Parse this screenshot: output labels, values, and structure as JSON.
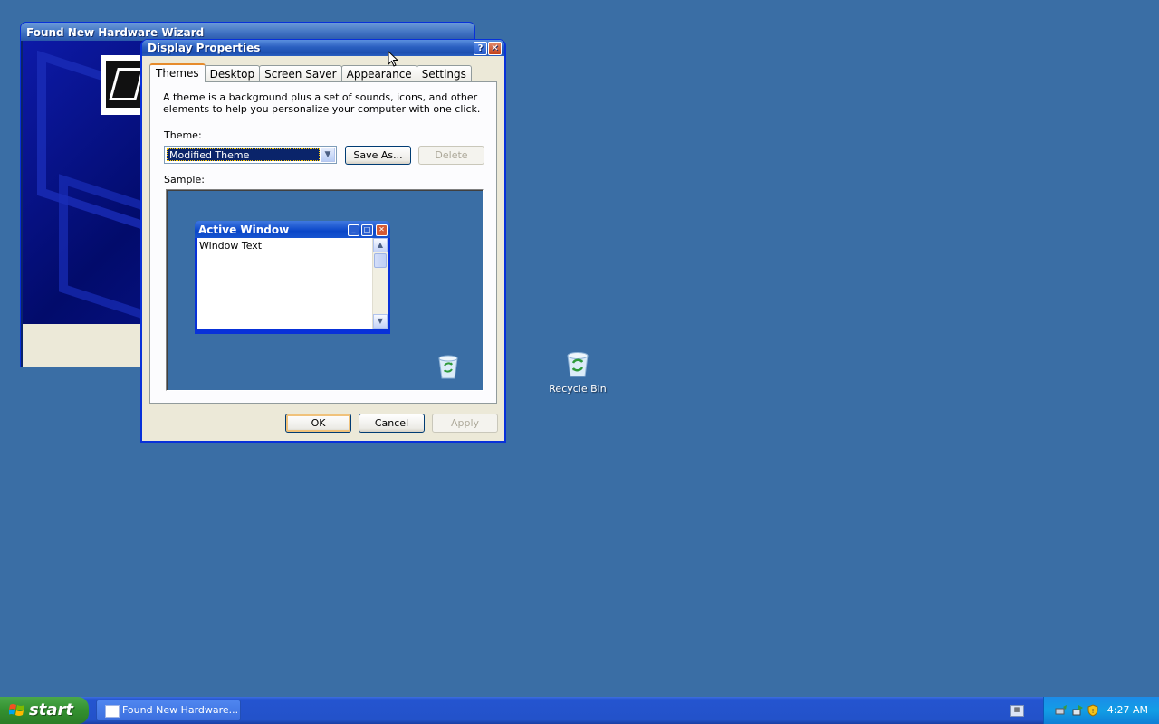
{
  "desktop": {
    "recycle_bin_label": "Recycle Bin"
  },
  "wizard": {
    "title": "Found New Hardware Wizard"
  },
  "dialog": {
    "title": "Display Properties",
    "help_glyph": "?",
    "close_glyph": "✕",
    "tabs": [
      "Themes",
      "Desktop",
      "Screen Saver",
      "Appearance",
      "Settings"
    ],
    "active_tab": "Themes",
    "description": "A theme is a background plus a set of sounds, icons, and other elements to help you personalize your computer with one click.",
    "theme_label": "Theme:",
    "theme_value": "Modified Theme",
    "save_as_label": "Save As...",
    "delete_label": "Delete",
    "sample_label": "Sample:",
    "sample_window_title": "Active Window",
    "sample_window_text": "Window Text",
    "ok_label": "OK",
    "cancel_label": "Cancel",
    "apply_label": "Apply"
  },
  "taskbar": {
    "start_label": "start",
    "task_label": "Found New Hardware...",
    "clock": "4:27 AM"
  },
  "colors": {
    "desktop": "#3a6ea5",
    "title_blue": "#0831d9",
    "start_green": "#33902f",
    "tray_blue": "#129ee6"
  }
}
